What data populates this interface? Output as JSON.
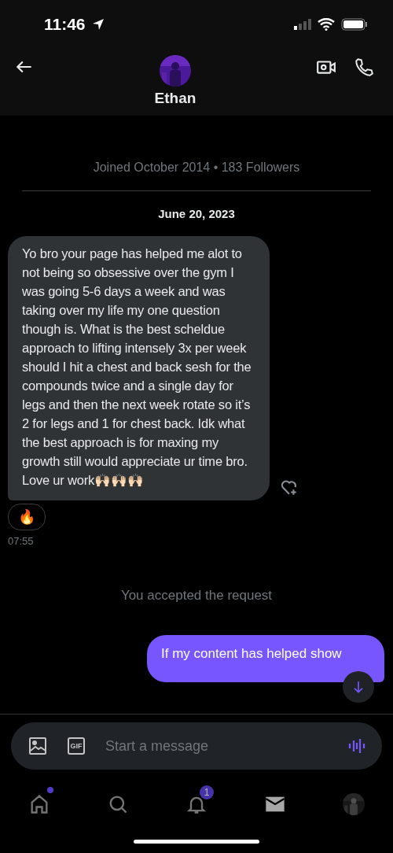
{
  "status_bar": {
    "time": "11:46"
  },
  "header": {
    "name": "Ethan"
  },
  "conversation": {
    "profile_info": "Joined October 2014 • 183 Followers",
    "date": "June 20, 2023",
    "incoming": {
      "text": "Yo bro your page has helped me alot to not being so obsessive over the gym I was going 5-6 days a week and was taking over my life my one question though is. What is the best scheldue approach to lifting intensely 3x per week should I hit a chest and back sesh for the compounds twice and a single day for legs and then the next week rotate so it’s 2 for legs and 1 for chest back. Idk what the best approach is for maxing my growth still would appreciate ur time bro. Love ur work🙌🏻🙌🏻🙌🏻",
      "reaction": "🔥",
      "time": "07:55"
    },
    "system_notice": "You accepted the request",
    "outgoing": {
      "text": "If my content has helped show"
    }
  },
  "composer": {
    "gif_label": "GIF",
    "placeholder": "Start a message"
  },
  "tab_bar": [
    {
      "kind": "home",
      "selected": false,
      "new_dot": true
    },
    {
      "kind": "search",
      "selected": false,
      "new_dot": false
    },
    {
      "kind": "notifications",
      "selected": false,
      "new_dot": false,
      "badge": "1"
    },
    {
      "kind": "messages",
      "selected": true,
      "new_dot": false
    },
    {
      "kind": "profile",
      "selected": false,
      "new_dot": false
    }
  ]
}
